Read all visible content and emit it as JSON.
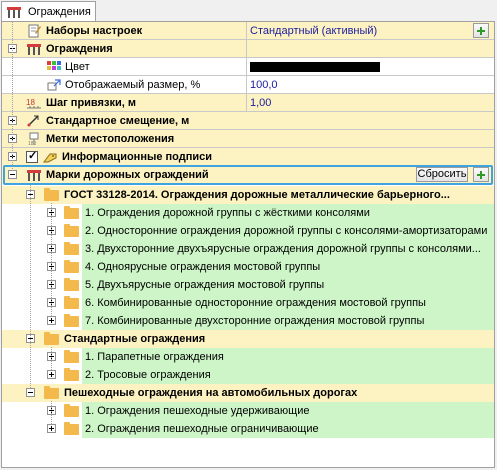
{
  "tab": {
    "label": "Ограждения"
  },
  "rows": {
    "presets": {
      "label": "Наборы настроек",
      "value": "Стандартный (активный)"
    },
    "fences": {
      "label": "Ограждения"
    },
    "color": {
      "label": "Цвет"
    },
    "size": {
      "label": "Отображаемый размер, %",
      "value": "100,0"
    },
    "snap": {
      "label": "Шаг привязки, м",
      "value": "1,00"
    },
    "offset": {
      "label": "Стандартное смещение, м"
    },
    "location_marks": {
      "label": "Метки местоположения"
    },
    "info_labels": {
      "label": "Информационные подписи"
    },
    "road_fence_marks": {
      "label": "Марки дорожных ограждений",
      "reset_label": "Сбросить"
    },
    "gost": {
      "label": "ГОСТ 33128-2014. Ограждения дорожные металлические барьерного..."
    },
    "gost_items": [
      "1. Ограждения дорожной группы с жёсткими консолями",
      "2. Односторонние ограждения дорожной группы с консолями-амортизаторами",
      "3. Двухсторонние двухъярусные ограждения дорожной группы с консолями...",
      "4. Одноярусные ограждения мостовой группы",
      "5. Двухъярусные ограждения мостовой группы",
      "6. Комбинированные односторонние ограждения мостовой группы",
      "7. Комбинированные двухсторонние ограждения мостовой группы"
    ],
    "standard": {
      "label": "Стандартные ограждения"
    },
    "standard_items": [
      "1. Парапетные ограждения",
      "2. Тросовые ограждения"
    ],
    "pedestrian": {
      "label": "Пешеходные ограждения на автомобильных дорогах"
    },
    "pedestrian_items": [
      "1. Ограждения пешеходные удерживающие",
      "2. Ограждения пешеходные ограничивающие"
    ]
  },
  "colors": {
    "category_bg": "#fdf3c2",
    "property_bg": "#ffffff",
    "green_bg": "#cdf5c7",
    "selection_border": "#3ea4e0",
    "value_text": "#1a1aa0",
    "color_swatch": "#000000"
  }
}
